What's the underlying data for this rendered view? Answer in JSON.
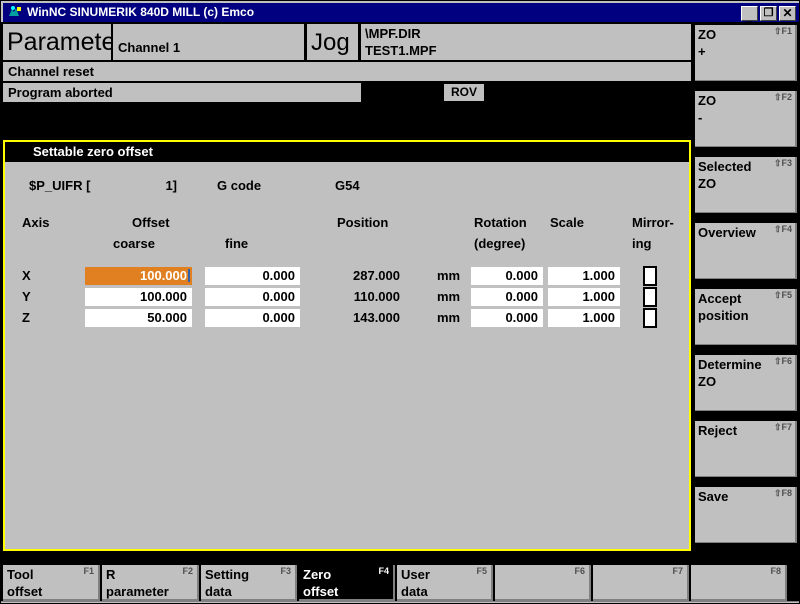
{
  "window": {
    "title": "WinNC SINUMERIK 840D MILL (c) Emco",
    "icon": "app-icon",
    "minimize_label": "_",
    "maximize_label": "❐",
    "close_label": "✕"
  },
  "header": {
    "area": "Parameter",
    "channel": "Channel 1",
    "mode": "Jog",
    "program_dir": "\\MPF.DIR",
    "program_name": "TEST1.MPF",
    "status_channel": "Channel reset",
    "status_program": "Program aborted",
    "rov_badge": "ROV"
  },
  "panel": {
    "title": "Settable zero offset",
    "frame_color": "#ffff00",
    "variable_label": "$P_UIFR  [",
    "variable_index": "1]",
    "gcode_label": "G code",
    "gcode_value": "G54",
    "columns": {
      "axis": "Axis",
      "offset": "Offset",
      "offset_coarse": "coarse",
      "offset_fine": "fine",
      "position": "Position",
      "rotation": "Rotation",
      "rotation_unit": "(degree)",
      "scale": "Scale",
      "mirroring_1": "Mirror-",
      "mirroring_2": "ing"
    },
    "rows": [
      {
        "axis": "X",
        "coarse": "100.000",
        "coarse_selected": true,
        "fine": "0.000",
        "position": "287.000",
        "unit": "mm",
        "rotation": "0.000",
        "scale": "1.000",
        "mirroring": false
      },
      {
        "axis": "Y",
        "coarse": "100.000",
        "coarse_selected": false,
        "fine": "0.000",
        "position": "110.000",
        "unit": "mm",
        "rotation": "0.000",
        "scale": "1.000",
        "mirroring": false
      },
      {
        "axis": "Z",
        "coarse": "50.000",
        "coarse_selected": false,
        "fine": "0.000",
        "position": "143.000",
        "unit": "mm",
        "rotation": "0.000",
        "scale": "1.000",
        "mirroring": false
      }
    ]
  },
  "vertical_softkeys": [
    {
      "label": "ZO\n+",
      "line1": "ZO",
      "line2": "+",
      "fkey": "⇧F1"
    },
    {
      "label": "ZO\n-",
      "line1": "ZO",
      "line2": "-",
      "fkey": "⇧F2"
    },
    {
      "label": "Selected ZO",
      "line1": "Selected",
      "line2": "ZO",
      "fkey": "⇧F3"
    },
    {
      "label": "Overview",
      "line1": "Overview",
      "line2": "",
      "fkey": "⇧F4"
    },
    {
      "label": "Accept position",
      "line1": "Accept",
      "line2": "position",
      "fkey": "⇧F5"
    },
    {
      "label": "Determine ZO",
      "line1": "Determine",
      "line2": "ZO",
      "fkey": "⇧F6"
    },
    {
      "label": "Reject",
      "line1": "Reject",
      "line2": "",
      "fkey": "⇧F7"
    },
    {
      "label": "Save",
      "line1": "Save",
      "line2": "",
      "fkey": "⇧F8"
    }
  ],
  "horizontal_softkeys": [
    {
      "line1": "Tool",
      "line2": "offset",
      "fkey": "F1",
      "active": false
    },
    {
      "line1": "R",
      "line2": "parameter",
      "fkey": "F2",
      "active": false
    },
    {
      "line1": "Setting",
      "line2": "data",
      "fkey": "F3",
      "active": false
    },
    {
      "line1": "Zero",
      "line2": "offset",
      "fkey": "F4",
      "active": true
    },
    {
      "line1": "User",
      "line2": "data",
      "fkey": "F5",
      "active": false
    },
    {
      "line1": "",
      "line2": "",
      "fkey": "F6",
      "active": false
    },
    {
      "line1": "",
      "line2": "",
      "fkey": "F7",
      "active": false
    },
    {
      "line1": "",
      "line2": "",
      "fkey": "F8",
      "active": false
    }
  ]
}
